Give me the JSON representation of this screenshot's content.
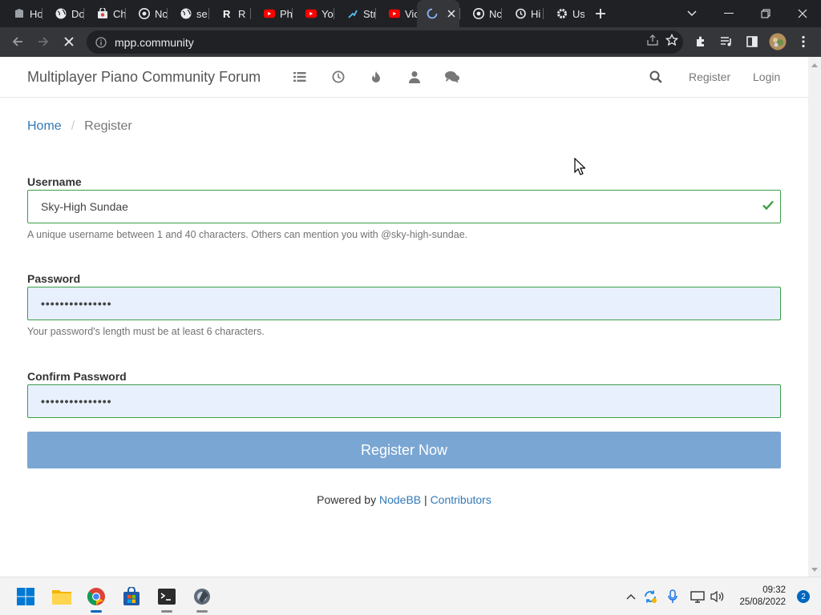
{
  "browser": {
    "tabs": [
      {
        "label": "Ho",
        "icon": "doc-icon",
        "color": "#9aa0a6"
      },
      {
        "label": "Do",
        "icon": "globe-icon",
        "color": "#e8eaed"
      },
      {
        "label": "Ch",
        "icon": "chrome-store-icon",
        "color": "#e8eaed"
      },
      {
        "label": "Nc",
        "icon": "chrome-icon",
        "color": "#e8eaed"
      },
      {
        "label": "se",
        "icon": "globe-icon",
        "color": "#e8eaed"
      },
      {
        "label": "R",
        "icon": "r-logo-icon",
        "color": "#ffffff"
      },
      {
        "label": "Ph",
        "icon": "youtube-icon",
        "color": "#ff0000"
      },
      {
        "label": "Yo",
        "icon": "youtube-icon",
        "color": "#ff0000"
      },
      {
        "label": "Str",
        "icon": "steam-icon",
        "color": "#4fc3f7"
      },
      {
        "label": "Vic",
        "icon": "youtube-icon",
        "color": "#ff0000"
      },
      {
        "label": "",
        "icon": "loading-spinner-icon",
        "color": "#8ab4f8",
        "active": true
      },
      {
        "label": "Nc",
        "icon": "chrome-icon",
        "color": "#e8eaed"
      },
      {
        "label": "Hi",
        "icon": "history-icon",
        "color": "#e8eaed"
      },
      {
        "label": "Us",
        "icon": "settings-gear-icon",
        "color": "#e8eaed"
      }
    ],
    "url": "mpp.community"
  },
  "site": {
    "brand": "Multiplayer Piano Community Forum",
    "nav_register": "Register",
    "nav_login": "Login"
  },
  "breadcrumb": {
    "home": "Home",
    "separator": "/",
    "current": "Register"
  },
  "form": {
    "username_label": "Username",
    "username_value": "Sky-High Sundae",
    "username_help": "A unique username between 1 and 40 characters. Others can mention you with @sky-high-sundae.",
    "password_label": "Password",
    "password_value": "•••••••••••••••",
    "password_help": "Your password's length must be at least 6 characters.",
    "confirm_label": "Confirm Password",
    "confirm_value": "•••••••••••••••",
    "submit_label": "Register Now"
  },
  "footer": {
    "powered_by": "Powered by",
    "nodebb": "NodeBB",
    "separator": "|",
    "contributors": "Contributors"
  },
  "taskbar": {
    "time": "09:32",
    "date": "25/08/2022",
    "notifications": "2"
  },
  "colors": {
    "link": "#337ab7",
    "valid_border": "#3c9e47",
    "submit_bg": "#7aa6d3",
    "autofill_bg": "#e8f0fe"
  }
}
